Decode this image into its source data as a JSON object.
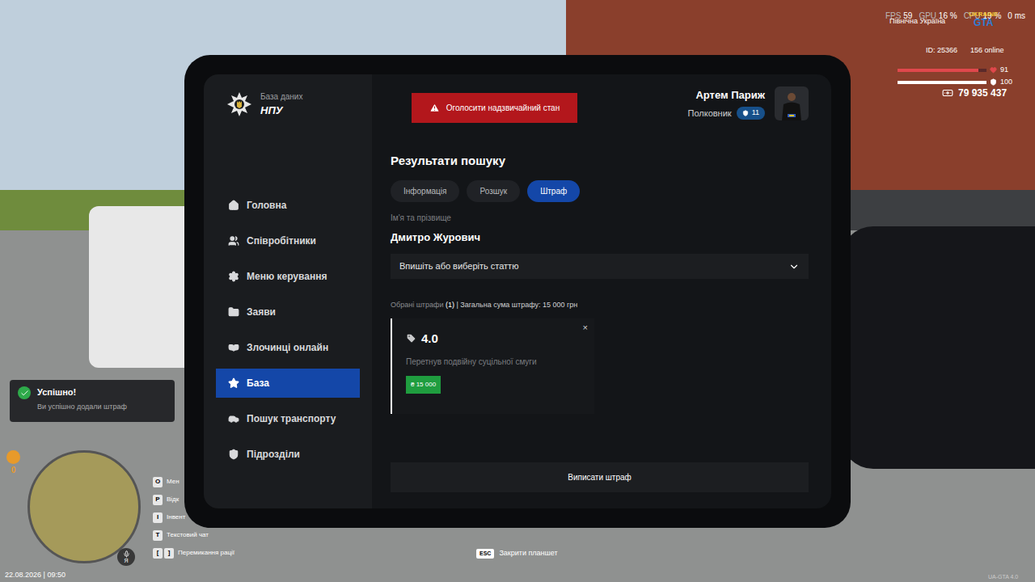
{
  "hud": {
    "fps_label": "FPS",
    "fps": "59",
    "gpu_label": "GPU",
    "gpu": "16 %",
    "cpu_label": "CPU",
    "cpu": "19 %",
    "ping": "0 ms",
    "server": "Північна Україна",
    "logo_top": "UKRAINE",
    "logo_bottom": "GTA",
    "player_id": "ID: 25366",
    "online": "156 online",
    "health": {
      "value": "91",
      "level": 0.91
    },
    "armor": {
      "value": "100",
      "level": 1
    },
    "money": "79 935 437"
  },
  "notification": {
    "title": "Успішно!",
    "message": "Ви успішно додали штраф"
  },
  "minimap": {
    "badge": "0"
  },
  "key_hints": [
    {
      "keys": [
        "O"
      ],
      "label": "Мен"
    },
    {
      "keys": [
        "P"
      ],
      "label": "Відк"
    },
    {
      "keys": [
        "I"
      ],
      "label": "Інвент"
    },
    {
      "keys": [
        "T"
      ],
      "label": "Текстовий чат"
    },
    {
      "keys": [
        "[",
        "]"
      ],
      "label": "Перемикання рації"
    }
  ],
  "voice_key": "Я",
  "datetime": "22.08.2026 | 09:50",
  "close_hint": {
    "key": "ESC",
    "label": "Закрити планшет"
  },
  "version": "UA-GTA 4.0",
  "tablet": {
    "brand": {
      "subtitle": "База даних",
      "title": "НПУ"
    },
    "emergency_button": "Оголосити надзвичайний стан",
    "user": {
      "name": "Артем Париж",
      "rank": "Полковник",
      "level": "11"
    },
    "sidebar": {
      "items": [
        {
          "label": "Головна",
          "selected": false
        },
        {
          "label": "Співробітники",
          "selected": false
        },
        {
          "label": "Меню керування",
          "selected": false
        },
        {
          "label": "Заяви",
          "selected": false
        },
        {
          "label": "Злочинці онлайн",
          "selected": false
        },
        {
          "label": "База",
          "selected": true
        },
        {
          "label": "Пошук транспорту",
          "selected": false
        },
        {
          "label": "Підрозділи",
          "selected": false
        }
      ]
    },
    "content": {
      "title": "Результати пошуку",
      "tabs": [
        {
          "label": "Інформація",
          "selected": false
        },
        {
          "label": "Розшук",
          "selected": false
        },
        {
          "label": "Штраф",
          "selected": true
        }
      ],
      "name_label": "Ім'я та прізвище",
      "name": "Дмитро Журович",
      "article_select": {
        "placeholder": "Впишіть або виберіть статтю"
      },
      "summary": {
        "label": "Обрані штрафи",
        "count": "(1)",
        "total": "| Загальна сума штрафу: 15 000 грн"
      },
      "fines": [
        {
          "article": "4.0",
          "description": "Перетнув подвійну суцільної смуги",
          "amount": "₴ 15 000",
          "remove": "×"
        }
      ],
      "submit_button": "Виписати штраф"
    }
  }
}
